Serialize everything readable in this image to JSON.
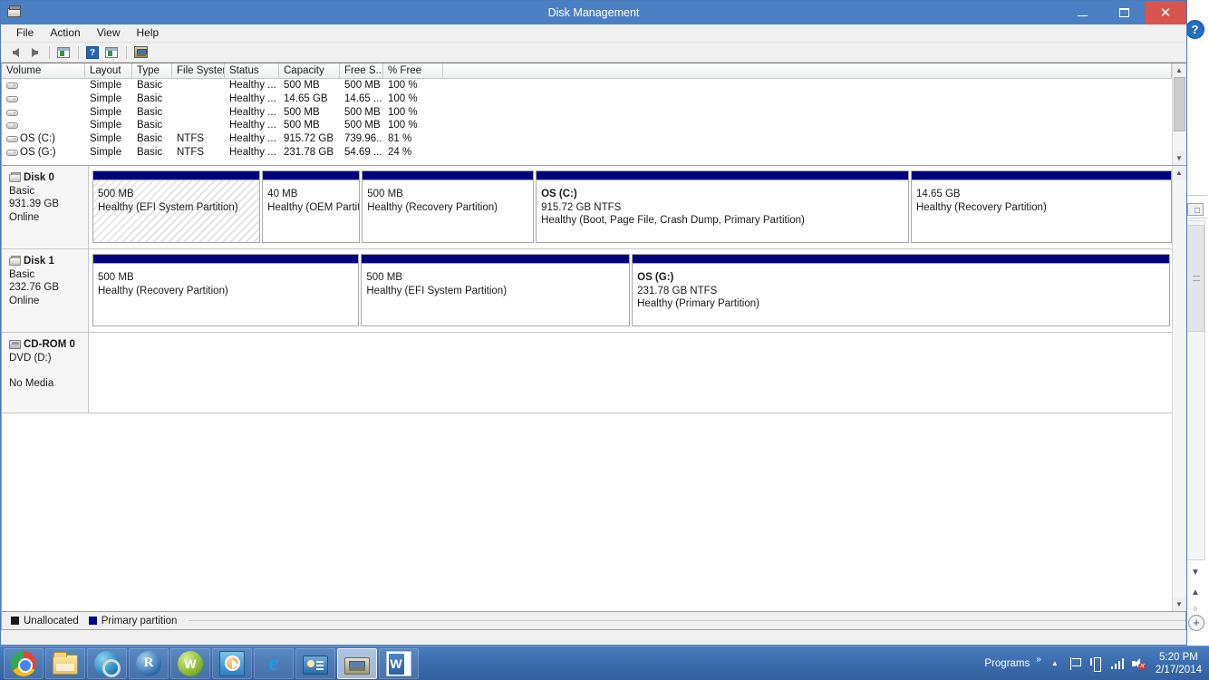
{
  "window": {
    "title": "Disk Management",
    "icon": "disk-management-icon",
    "buttons": {
      "minimize": "–",
      "maximize": "❐",
      "close": "✕"
    }
  },
  "menubar": {
    "items": [
      "File",
      "Action",
      "View",
      "Help"
    ]
  },
  "toolbar": {
    "items": [
      {
        "name": "back-icon",
        "label": "Back"
      },
      {
        "name": "forward-icon",
        "label": "Forward"
      },
      {
        "name": "show-hide-console-tree-icon",
        "label": "Show/Hide Console Tree"
      },
      {
        "name": "help-icon",
        "label": "Help"
      },
      {
        "name": "show-hide-action-pane-icon",
        "label": "Show/Hide Action Pane"
      },
      {
        "name": "rescan-disks-icon",
        "label": "Rescan Disks"
      }
    ]
  },
  "volume_list": {
    "columns": [
      "Volume",
      "Layout",
      "Type",
      "File System",
      "Status",
      "Capacity",
      "Free S...",
      "% Free"
    ],
    "rows": [
      {
        "volume": "",
        "layout": "Simple",
        "type": "Basic",
        "filesystem": "",
        "status": "Healthy ...",
        "capacity": "500 MB",
        "free": "500 MB",
        "pctfree": "100 %"
      },
      {
        "volume": "",
        "layout": "Simple",
        "type": "Basic",
        "filesystem": "",
        "status": "Healthy ...",
        "capacity": "14.65 GB",
        "free": "14.65 ...",
        "pctfree": "100 %"
      },
      {
        "volume": "",
        "layout": "Simple",
        "type": "Basic",
        "filesystem": "",
        "status": "Healthy ...",
        "capacity": "500 MB",
        "free": "500 MB",
        "pctfree": "100 %"
      },
      {
        "volume": "",
        "layout": "Simple",
        "type": "Basic",
        "filesystem": "",
        "status": "Healthy ...",
        "capacity": "500 MB",
        "free": "500 MB",
        "pctfree": "100 %"
      },
      {
        "volume": "OS  (C:)",
        "layout": "Simple",
        "type": "Basic",
        "filesystem": "NTFS",
        "status": "Healthy ...",
        "capacity": "915.72 GB",
        "free": "739.96...",
        "pctfree": "81 %"
      },
      {
        "volume": "OS  (G:)",
        "layout": "Simple",
        "type": "Basic",
        "filesystem": "NTFS",
        "status": "Healthy ...",
        "capacity": "231.78 GB",
        "free": "54.69 ...",
        "pctfree": "24 %"
      }
    ]
  },
  "disks": [
    {
      "name": "Disk 0",
      "type": "Basic",
      "size": "931.39 GB",
      "status": "Online",
      "partitions": [
        {
          "label": "",
          "size": "500 MB",
          "status": "Healthy (EFI System Partition)",
          "width_pct": 15.6,
          "hatched": true
        },
        {
          "label": "",
          "size": "40 MB",
          "status": "Healthy (OEM Partition)",
          "width_pct": 9.1,
          "hatched": false
        },
        {
          "label": "",
          "size": "500 MB",
          "status": "Healthy (Recovery Partition)",
          "width_pct": 16.0,
          "hatched": false
        },
        {
          "label": "OS  (C:)",
          "size": "915.72 GB NTFS",
          "status": "Healthy (Boot, Page File, Crash Dump, Primary Partition)",
          "width_pct": 34.7,
          "hatched": false
        },
        {
          "label": "",
          "size": "14.65 GB",
          "status": "Healthy (Recovery Partition)",
          "width_pct": 24.3,
          "hatched": false
        }
      ]
    },
    {
      "name": "Disk 1",
      "type": "Basic",
      "size": "232.76 GB",
      "status": "Online",
      "partitions": [
        {
          "label": "",
          "size": "500 MB",
          "status": "Healthy (Recovery Partition)",
          "width_pct": 24.8,
          "hatched": false
        },
        {
          "label": "",
          "size": "500 MB",
          "status": "Healthy (EFI System Partition)",
          "width_pct": 25.0,
          "hatched": false
        },
        {
          "label": "OS  (G:)",
          "size": "231.78 GB NTFS",
          "status": "Healthy (Primary Partition)",
          "width_pct": 50.0,
          "hatched": false
        }
      ]
    }
  ],
  "cdrom": {
    "name": "CD-ROM 0",
    "drive": "DVD (D:)",
    "status": "No Media"
  },
  "legend": {
    "items": [
      {
        "label": "Unallocated",
        "color": "#1b1b1b"
      },
      {
        "label": "Primary partition",
        "color": "#000080"
      }
    ]
  },
  "taskbar": {
    "apps": [
      {
        "name": "chrome",
        "label": "Google Chrome",
        "active": false
      },
      {
        "name": "file-explorer",
        "label": "File Explorer",
        "active": false
      },
      {
        "name": "search-globe",
        "label": "Search",
        "active": false
      },
      {
        "name": "rstudio",
        "label": "R",
        "letter": "R",
        "active": false
      },
      {
        "name": "w-green-app",
        "label": "W",
        "letter": "W",
        "active": false
      },
      {
        "name": "media-player",
        "label": "Windows Media Player",
        "active": false
      },
      {
        "name": "internet-explorer",
        "label": "Internet Explorer",
        "letter": "e",
        "active": false
      },
      {
        "name": "contact-card-app",
        "label": "Contacts",
        "active": false
      },
      {
        "name": "disk-management",
        "label": "Disk Management",
        "active": true
      },
      {
        "name": "word",
        "label": "Microsoft Word",
        "letter": "W",
        "active": false
      }
    ],
    "tray": {
      "programs_label": "Programs",
      "overflow": "»",
      "show_hidden": "▲",
      "icons": [
        "action-center-flag-icon",
        "device-icon",
        "network-signal-icon",
        "volume-muted-icon"
      ],
      "time": "5:20 PM",
      "date": "2/17/2014"
    }
  },
  "background_app": {
    "help_badge": "?",
    "zoom_plus": "+"
  }
}
